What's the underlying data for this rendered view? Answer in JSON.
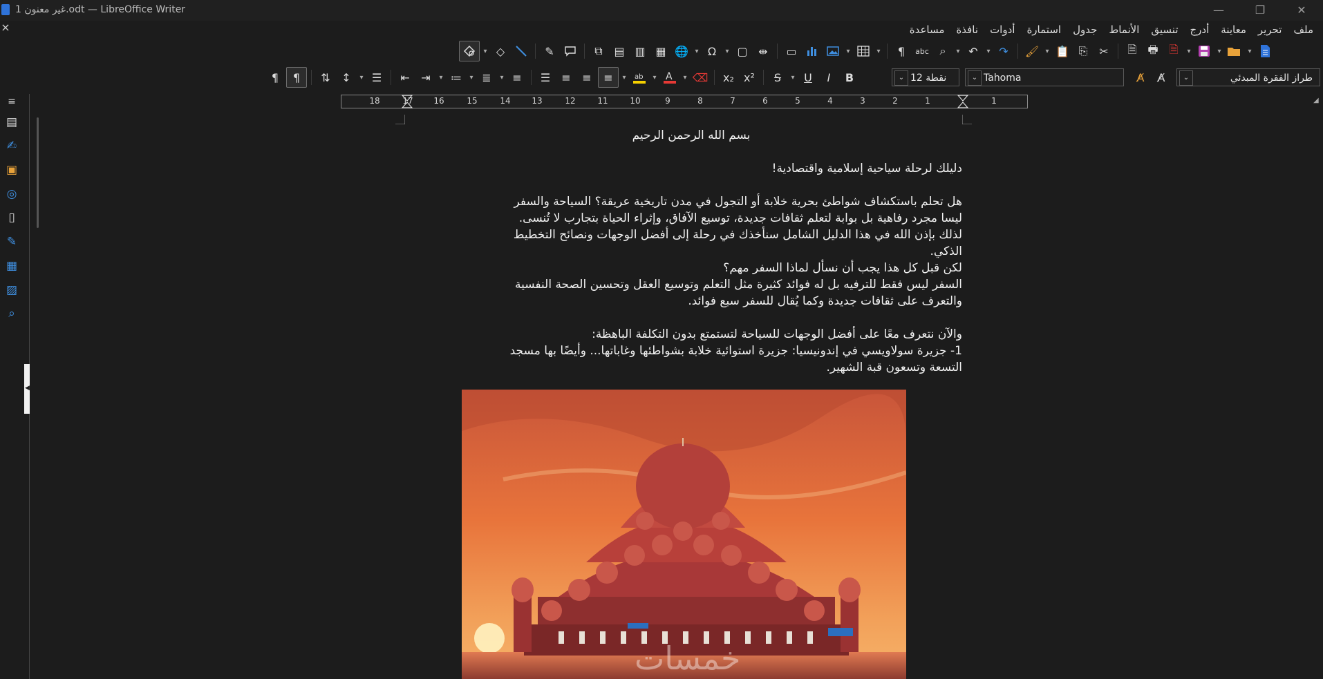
{
  "window": {
    "title": "غير معنون 1.odt — LibreOffice Writer",
    "minimize": "—",
    "restore": "❐",
    "close": "✕"
  },
  "doc_close": "×",
  "menu": [
    "ملف",
    "تحرير",
    "معاينة",
    "أدرج",
    "تنسيق",
    "الأنماط",
    "جدول",
    "استمارة",
    "أدوات",
    "نافذة",
    "مساعدة"
  ],
  "format": {
    "paragraph_style": "طراز الفقرة المبدئي",
    "font_name": "Tahoma",
    "font_size": "12 نقطة"
  },
  "ruler": [
    "18",
    "17",
    "16",
    "15",
    "14",
    "13",
    "12",
    "11",
    "10",
    "9",
    "8",
    "7",
    "6",
    "5",
    "4",
    "3",
    "2",
    "1",
    "1"
  ],
  "document": {
    "basmala": "بسم الله الرحمن الرحيم",
    "heading": "دليلك لرحلة سياحية إسلامية واقتصادية!",
    "paragraph1": [
      "هل تحلم باستكشاف شواطئ بحرية خلابة أو التجول في مدن تاريخية عريقة؟ السياحة والسفر",
      "ليسا مجرد رفاهية بل بوابة لتعلم ثقافات جديدة، توسيع الآفاق، وإثراء الحياة بتجارب لا تُنسى.",
      "لذلك بإذن الله في هذا الدليل الشامل سنأخذك في رحلة إلى أفضل الوجهات ونصائح التخطيط",
      "الذكي.",
      "لكن قبل كل هذا يجب أن نسأل لماذا السفر مهم؟",
      "السفر ليس فقط للترفيه بل له فوائد كثيرة مثل التعلم وتوسيع العقل وتحسين الصحة النفسية",
      "والتعرف على ثقافات جديدة وكما يُقال للسفر سبع فوائد."
    ],
    "paragraph2": [
      "والآن نتعرف معًا على أفضل الوجهات للسياحة لتستمتع بدون التكلفة الباهظة:",
      "1- جزيرة سولاويسي في إندونيسيا: جزيرة استوائية خلابة بشواطئها وغاباتها... وأيضًا بها مسجد",
      "التسعة وتسعون قبة الشهير."
    ],
    "image_watermark": "خمسات"
  },
  "colors": {
    "background": "#1c1c1c",
    "text": "#f0f0f0",
    "accent_blue": "#3f8fe0",
    "highlight_yellow": "#f5d000",
    "font_color_red": "#e53935",
    "sky_orange": "#e8743b",
    "mosque_red": "#b8403a"
  }
}
